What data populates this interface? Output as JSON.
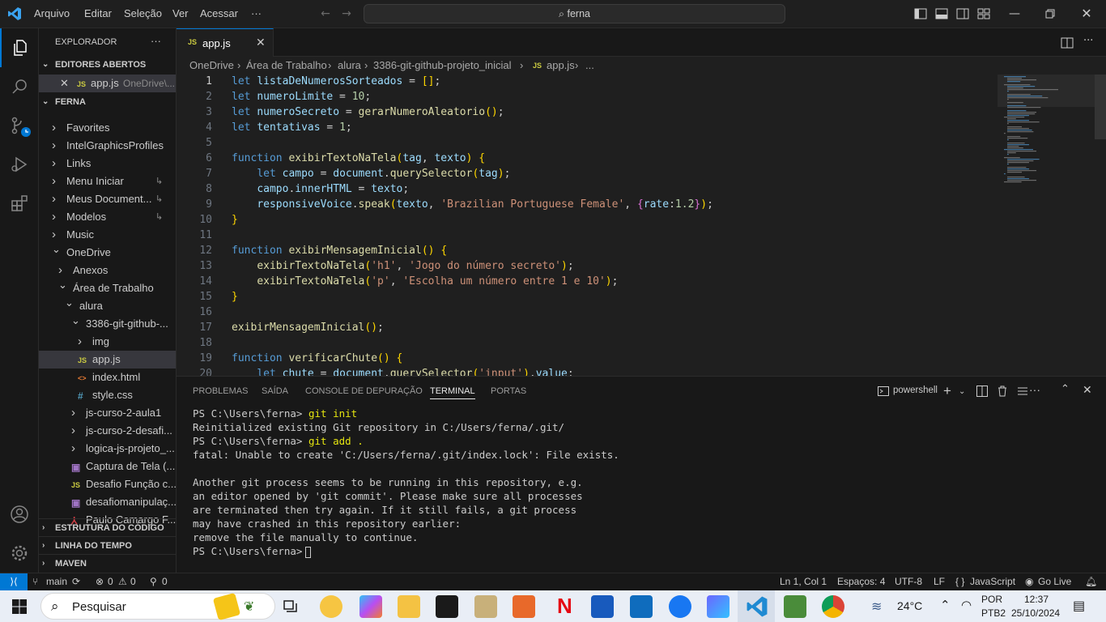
{
  "titlebar": {
    "menu": [
      "Arquivo",
      "Editar",
      "Seleção",
      "Ver",
      "Acessar",
      "···"
    ],
    "search_text": "ferna",
    "colors": {
      "accent": "#0078d4",
      "bg": "#1f1f1f"
    }
  },
  "activity": [
    "explorer-icon",
    "search-icon",
    "source-control-icon",
    "run-debug-icon",
    "extensions-icon",
    "account-icon",
    "manage-gear-icon"
  ],
  "sidebar": {
    "title": "EXPLORADOR",
    "more": "···",
    "open_editors_label": "EDITORES ABERTOS",
    "open_editor": {
      "icon": "JS",
      "name": "app.js",
      "path": "OneDrive\\..."
    },
    "root_label": "FERNA",
    "tree": [
      {
        "label": "Favorites",
        "kind": "folder",
        "depth": 0
      },
      {
        "label": "IntelGraphicsProfiles",
        "kind": "folder",
        "depth": 0
      },
      {
        "label": "Links",
        "kind": "folder",
        "depth": 0
      },
      {
        "label": "Menu Iniciar",
        "kind": "folder",
        "depth": 0,
        "link": true
      },
      {
        "label": "Meus Document...",
        "kind": "folder",
        "depth": 0,
        "link": true
      },
      {
        "label": "Modelos",
        "kind": "folder",
        "depth": 0,
        "link": true
      },
      {
        "label": "Music",
        "kind": "folder",
        "depth": 0
      },
      {
        "label": "OneDrive",
        "kind": "folder-open",
        "depth": 0
      },
      {
        "label": "Anexos",
        "kind": "folder",
        "depth": 1
      },
      {
        "label": "Área de Trabalho",
        "kind": "folder-open",
        "depth": 1
      },
      {
        "label": "alura",
        "kind": "folder-open",
        "depth": 2
      },
      {
        "label": "3386-git-github-...",
        "kind": "folder-open",
        "depth": 3
      },
      {
        "label": "img",
        "kind": "folder",
        "depth": 4
      },
      {
        "label": "app.js",
        "kind": "js",
        "depth": 4,
        "active": true
      },
      {
        "label": "index.html",
        "kind": "html",
        "depth": 4
      },
      {
        "label": "style.css",
        "kind": "css",
        "depth": 4
      },
      {
        "label": "js-curso-2-aula1",
        "kind": "folder",
        "depth": 3
      },
      {
        "label": "js-curso-2-desafi...",
        "kind": "folder",
        "depth": 3
      },
      {
        "label": "logica-js-projeto_...",
        "kind": "folder",
        "depth": 3
      },
      {
        "label": "Captura de Tela (...",
        "kind": "img",
        "depth": 3
      },
      {
        "label": "Desafio Função c...",
        "kind": "js",
        "depth": 3
      },
      {
        "label": "desafiomanipulaç...",
        "kind": "img",
        "depth": 3
      },
      {
        "label": "Paulo Camargo F...",
        "kind": "pdf",
        "depth": 3
      }
    ],
    "bottom_sections": [
      "ESTRUTURA DO CÓDIGO",
      "LINHA DO TEMPO",
      "MAVEN"
    ]
  },
  "editor": {
    "tab": {
      "icon": "JS",
      "name": "app.js",
      "close": "✕"
    },
    "breadcrumb": [
      "OneDrive",
      "Área de Trabalho",
      "alura",
      "3386-git-github-projeto_inicial",
      "app.js",
      "..."
    ],
    "line_numbers": [
      "1",
      "2",
      "3",
      "4",
      "5",
      "6",
      "7",
      "8",
      "9",
      "10",
      "11",
      "12",
      "13",
      "14",
      "15",
      "16",
      "17",
      "18",
      "19",
      "20"
    ],
    "lines": [
      "let listaDeNumerosSorteados = [];",
      "let numeroLimite = 10;",
      "let numeroSecreto = gerarNumeroAleatorio();",
      "let tentativas = 1;",
      "",
      "function exibirTextoNaTela(tag, texto) {",
      "    let campo = document.querySelector(tag);",
      "    campo.innerHTML = texto;",
      "    responsiveVoice.speak(texto, 'Brazilian Portuguese Female', {rate:1.2});",
      "}",
      "",
      "function exibirMensagemInicial() {",
      "    exibirTextoNaTela('h1', 'Jogo do número secreto');",
      "    exibirTextoNaTela('p', 'Escolha um número entre 1 e 10');",
      "}",
      "",
      "exibirMensagemInicial();",
      "",
      "function verificarChute() {",
      "    let chute = document.querySelector('input').value;"
    ]
  },
  "panel": {
    "tabs": [
      "PROBLEMAS",
      "SAÍDA",
      "CONSOLE DE DEPURAÇÃO",
      "TERMINAL",
      "PORTAS"
    ],
    "active_tab": "TERMINAL",
    "shell": "powershell",
    "terminal": [
      {
        "prompt": "PS C:\\Users\\ferna> ",
        "cmd": "git init"
      },
      {
        "text": "Reinitialized existing Git repository in C:/Users/ferna/.git/"
      },
      {
        "prompt": "PS C:\\Users\\ferna> ",
        "cmd": "git add ."
      },
      {
        "text": "fatal: Unable to create 'C:/Users/ferna/.git/index.lock': File exists."
      },
      {
        "text": ""
      },
      {
        "text": "Another git process seems to be running in this repository, e.g."
      },
      {
        "text": "an editor opened by 'git commit'. Please make sure all processes"
      },
      {
        "text": "are terminated then try again. If it still fails, a git process"
      },
      {
        "text": "may have crashed in this repository earlier:"
      },
      {
        "text": "remove the file manually to continue."
      },
      {
        "prompt": "PS C:\\Users\\ferna> ",
        "cmd": ""
      }
    ]
  },
  "statusbar": {
    "branch": "main",
    "errors": "0",
    "warnings": "0",
    "ports": "0",
    "position": "Ln 1, Col 1",
    "spaces": "Espaços: 4",
    "encoding": "UTF-8",
    "eol": "LF",
    "language": "JavaScript",
    "golive": "Go Live"
  },
  "taskbar": {
    "search_placeholder": "Pesquisar",
    "weather": "24°C",
    "lang1": "POR",
    "lang2": "PTB2",
    "time": "12:37",
    "date": "25/10/2024"
  }
}
